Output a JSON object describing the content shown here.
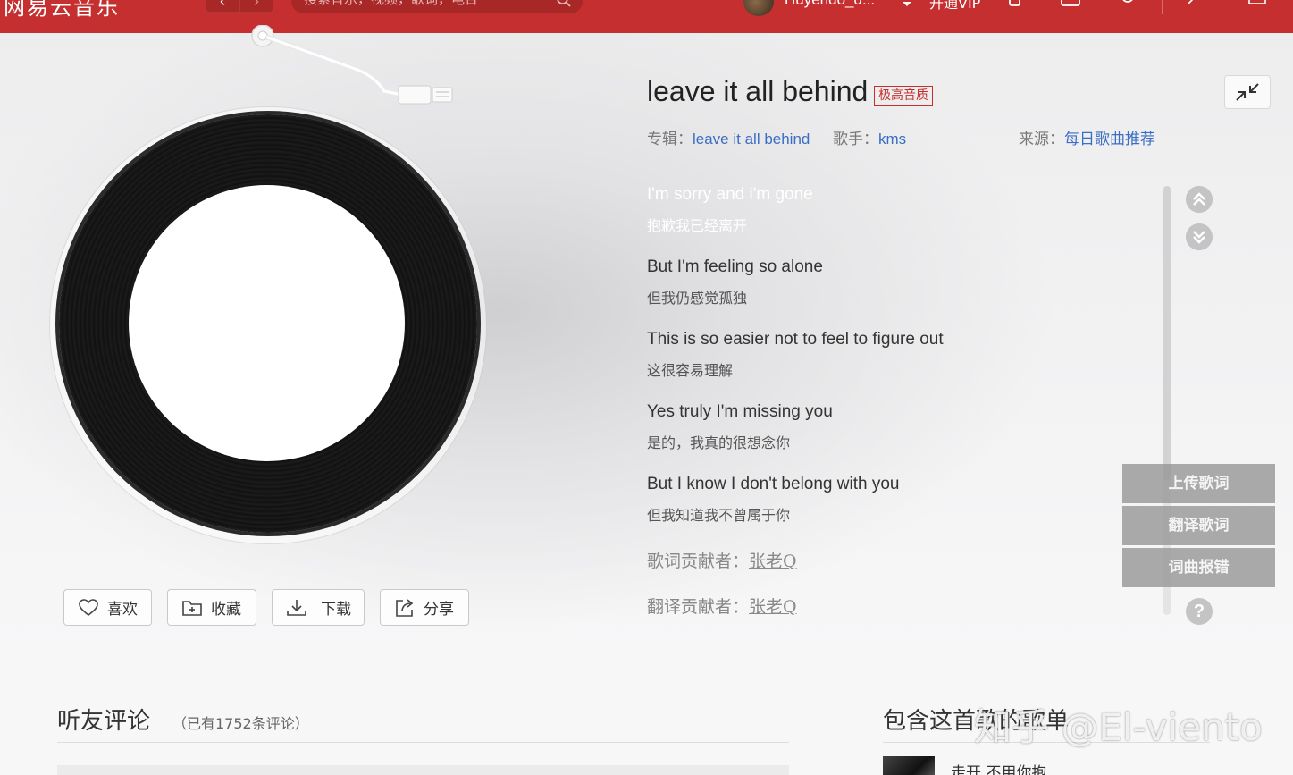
{
  "app": {
    "logo_text": "网易云音乐",
    "nav_back": "‹",
    "nav_forward": "›",
    "search_placeholder": "搜索音乐，视频，歌词，电台",
    "username": "Huyendo_d...",
    "vip_label": "开通VIP",
    "brand_color": "#c62f2f"
  },
  "song": {
    "title": "leave it all behind",
    "quality_badge": "极高音质",
    "album_label": "专辑：",
    "album": "leave it all behind",
    "artist_label": "歌手：",
    "artist": "kms",
    "source_label": "来源：",
    "source": "每日歌曲推荐"
  },
  "lyrics": [
    {
      "en": "I'm sorry and i'm gone",
      "zh": "抱歉我已经离开",
      "current": true
    },
    {
      "en": "But I'm feeling so alone",
      "zh": "但我仍感觉孤独",
      "current": false
    },
    {
      "en": "This is so easier not to feel to figure out",
      "zh": "这很容易理解",
      "current": false
    },
    {
      "en": "Yes truly I'm missing you",
      "zh": "是的，我真的很想念你",
      "current": false
    },
    {
      "en": "But I know I don't belong with you",
      "zh": "但我知道我不曾属于你",
      "current": false
    }
  ],
  "contributors": {
    "lyrics_label": "歌词贡献者：",
    "lyrics_name": "张老Q",
    "translation_label": "翻译贡献者：",
    "translation_name": "张老Q"
  },
  "actions": {
    "like": "喜欢",
    "collect": "收藏",
    "download": "下载",
    "share": "分享"
  },
  "side_menu": [
    "上传歌词",
    "翻译歌词",
    "词曲报错"
  ],
  "help_symbol": "?",
  "comments": {
    "title": "听友评论",
    "count_text": "（已有1752条评论）"
  },
  "playlists": {
    "title": "包含这首歌的歌单",
    "first_item": "走开 不用你抱"
  },
  "watermark": "知乎 @El-viento"
}
